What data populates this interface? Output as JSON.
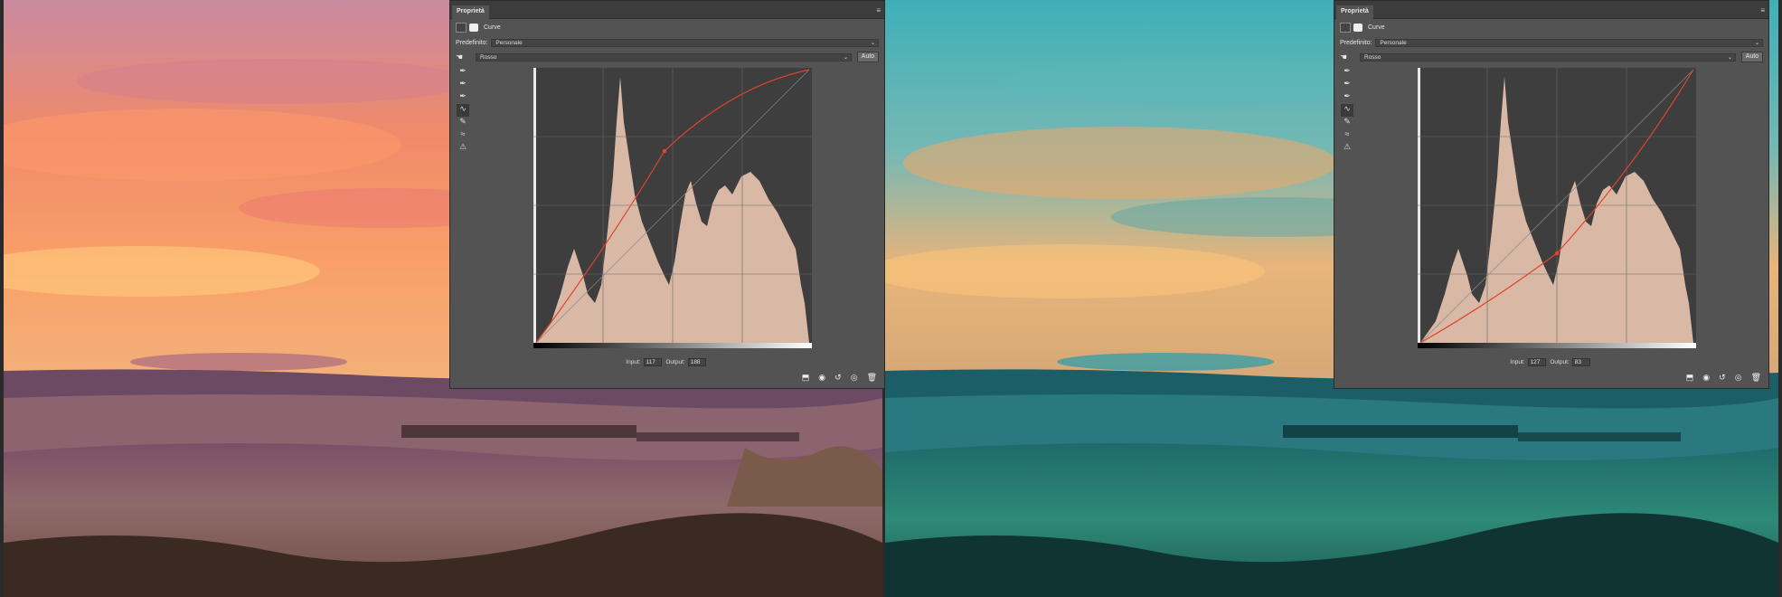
{
  "left": {
    "panel": {
      "tab_label": "Proprietà",
      "adjustment_title": "Curve",
      "preset_label": "Predefinito:",
      "preset_value": "Personale",
      "channel_value": "Rosso",
      "auto_label": "Auto",
      "input_label": "Input:",
      "input_value": "117",
      "output_label": "Output:",
      "output_value": "188"
    }
  },
  "right": {
    "panel": {
      "tab_label": "Proprietà",
      "adjustment_title": "Curve",
      "preset_label": "Predefinito:",
      "preset_value": "Personale",
      "channel_value": "Rosso",
      "auto_label": "Auto",
      "input_label": "Input:",
      "input_value": "127",
      "output_label": "Output:",
      "output_value": "83"
    }
  },
  "colors": {
    "curve_red": "#e0442a",
    "histogram_fill": "#d9b8a6",
    "grid_bg": "#3e3e3e"
  }
}
